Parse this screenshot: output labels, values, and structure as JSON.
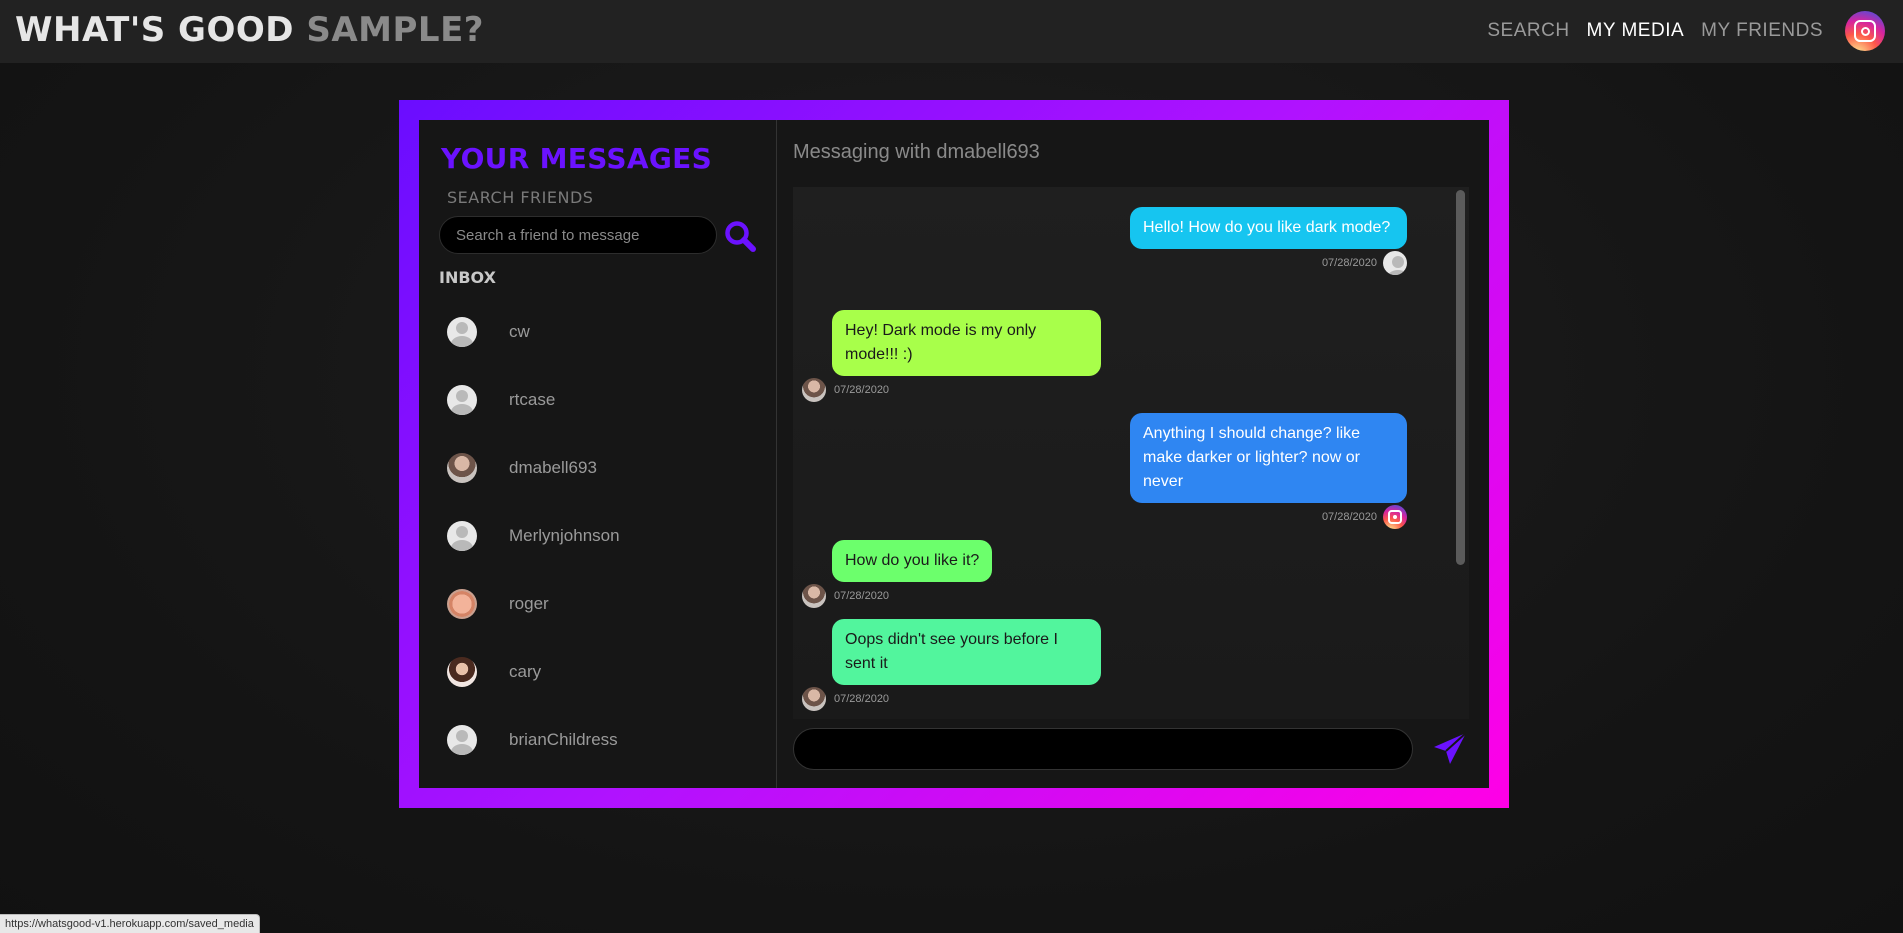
{
  "brand": {
    "part1": "WHAT'S GOOD",
    "part2": "SAMPLE?"
  },
  "nav": {
    "search": "SEARCH",
    "my_media": "MY MEDIA",
    "my_friends": "MY FRIENDS"
  },
  "sidebar": {
    "title": "YOUR MESSAGES",
    "search_label": "SEARCH FRIENDS",
    "search_placeholder": "Search a friend to message",
    "inbox_label": "INBOX",
    "friends": [
      {
        "name": "cw",
        "avatar": "default-avatar"
      },
      {
        "name": "rtcase",
        "avatar": "default-avatar"
      },
      {
        "name": "dmabell693",
        "avatar": "photo-avatar"
      },
      {
        "name": "Merlynjohnson",
        "avatar": "default-avatar"
      },
      {
        "name": "roger",
        "avatar": "baby-photo-avatar"
      },
      {
        "name": "cary",
        "avatar": "photo-avatar"
      },
      {
        "name": "brianChildress",
        "avatar": "default-avatar"
      }
    ]
  },
  "conversation": {
    "title": "Messaging with dmabell693",
    "messages": [
      {
        "direction": "sent",
        "text": "Hello! How do you like dark mode?",
        "date": "07/28/2020",
        "color": "#16c5f0",
        "avatar": "default-avatar"
      },
      {
        "direction": "received",
        "text": "Hey! Dark mode is my only mode!!! :)",
        "date": "07/28/2020",
        "color": "#a8ff4a",
        "avatar": "photo-avatar"
      },
      {
        "direction": "sent",
        "text": "Anything I should change? like make darker or lighter? now or never",
        "date": "07/28/2020",
        "color": "#2f86f2",
        "avatar": "instagram-avatar"
      },
      {
        "direction": "received",
        "text": "How do you like it?",
        "date": "07/28/2020",
        "color": "#6cff6c",
        "avatar": "photo-avatar"
      },
      {
        "direction": "received",
        "text": "Oops didn't see yours before I sent it",
        "date": "07/28/2020",
        "color": "#52f59d",
        "avatar": "photo-avatar"
      }
    ],
    "compose_value": ""
  },
  "colors": {
    "accent": "#6b12ff",
    "frame_start": "#6a0dff",
    "frame_end": "#ff00e6"
  },
  "statusbar": {
    "url": "https://whatsgood-v1.herokuapp.com/saved_media"
  }
}
